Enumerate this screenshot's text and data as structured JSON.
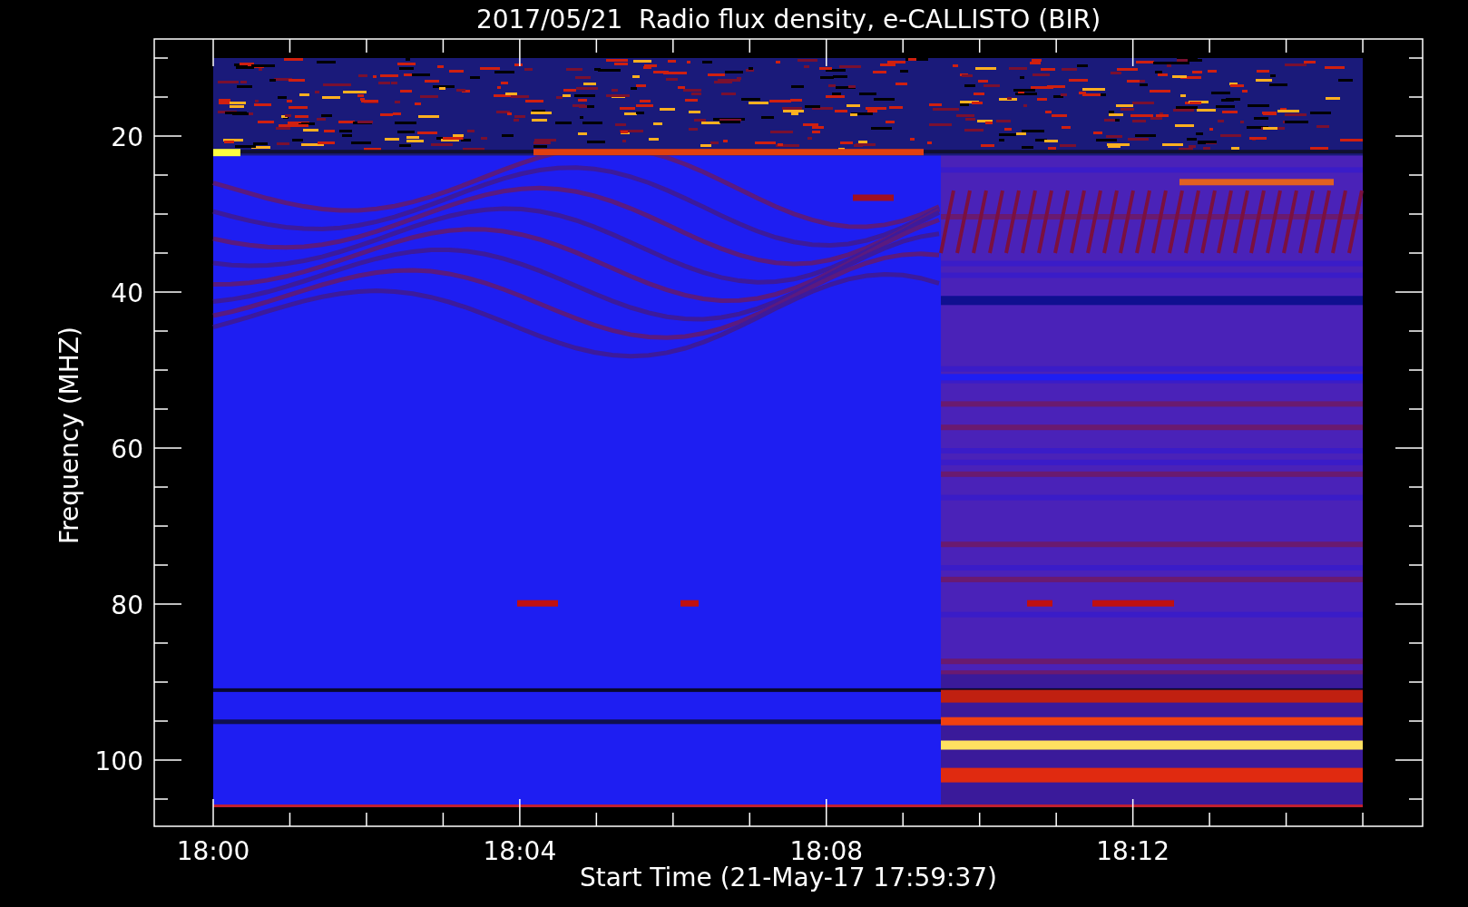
{
  "title": "2017/05/21  Radio flux density, e-CALLISTO (BIR)",
  "y_axis": {
    "label": "Frequency (MHZ)",
    "ticks": [
      "20",
      "40",
      "60",
      "80",
      "100"
    ]
  },
  "x_axis": {
    "label": "Start Time (21-May-17 17:59:37)",
    "ticks": [
      "18:00",
      "18:04",
      "18:08",
      "18:12"
    ]
  }
}
